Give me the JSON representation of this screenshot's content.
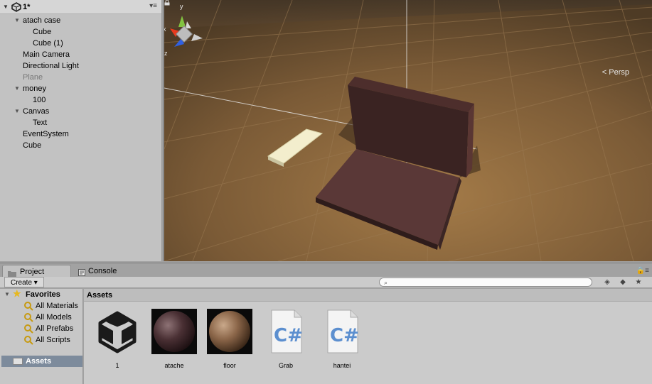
{
  "hierarchy": {
    "scene_name": "1*",
    "items": [
      {
        "label": "atach case"
      },
      {
        "label": "Cube"
      },
      {
        "label": "Cube (1)"
      },
      {
        "label": "Main Camera"
      },
      {
        "label": "Directional Light"
      },
      {
        "label": "Plane"
      },
      {
        "label": "money"
      },
      {
        "label": "100"
      },
      {
        "label": "Canvas"
      },
      {
        "label": "Text"
      },
      {
        "label": "EventSystem"
      },
      {
        "label": "Cube"
      }
    ]
  },
  "scene": {
    "projection_label": "Persp",
    "gizmo": {
      "x": "x",
      "y": "y",
      "z": "z"
    }
  },
  "project": {
    "tabs": [
      {
        "label": "Project"
      },
      {
        "label": "Console"
      }
    ],
    "create_label": "Create",
    "search_placeholder": "",
    "favorites_label": "Favorites",
    "favorites": [
      {
        "label": "All Materials"
      },
      {
        "label": "All Models"
      },
      {
        "label": "All Prefabs"
      },
      {
        "label": "All Scripts"
      }
    ],
    "assets_folder_label": "Assets",
    "breadcrumb": "Assets",
    "assets": [
      {
        "label": "1",
        "icon": "unity-scene-icon"
      },
      {
        "label": "atache",
        "icon": "material-sphere-icon"
      },
      {
        "label": "floor",
        "icon": "material-sphere-icon"
      },
      {
        "label": "Grab",
        "icon": "csharp-script-icon"
      },
      {
        "label": "hantei",
        "icon": "csharp-script-icon"
      }
    ]
  },
  "colors": {
    "scene_ground": "#7a5a36",
    "selection": "#7d8b9c",
    "favorites_star": "#e7b81e"
  }
}
